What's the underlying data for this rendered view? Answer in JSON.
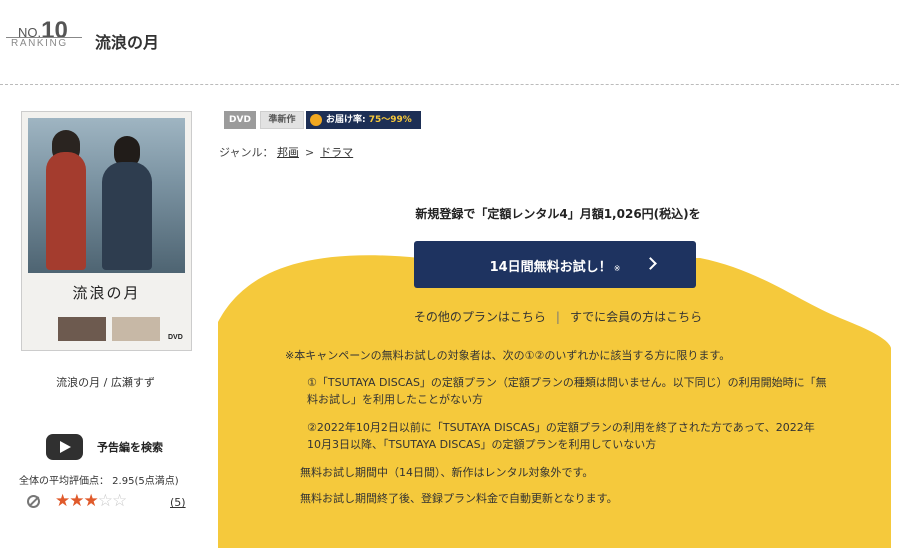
{
  "ranking": {
    "no_prefix": "NO.",
    "number": "10",
    "label": "RANKING"
  },
  "title": "流浪の月",
  "jacket": {
    "title": "流浪の月",
    "disc_mark": "DVD"
  },
  "cast": "流浪の月 / 広瀬すず",
  "trailer": {
    "label": "予告編を検索"
  },
  "rating": {
    "average_text": "全体の平均評価点： 2.95(5点満点)",
    "stars_filled": 3,
    "stars_total": 5,
    "review_count": "(5)"
  },
  "badges": {
    "format": "DVD",
    "status": "準新作",
    "delivery_prefix": "お届け率:",
    "delivery_value": "75〜99%"
  },
  "genre": {
    "prefix": "ジャンル：",
    "crumbs": [
      "邦画",
      "ドラマ"
    ],
    "separator": ">"
  },
  "campaign": {
    "promo": "新規登録で「定額レンタル4」月額1,026円(税込)を",
    "button_label": "14日間無料お試し！",
    "button_note": "※",
    "other_plans": "その他のプランはこちら",
    "member_link": "すでに会員の方はこちら",
    "divider": "|",
    "notes": [
      "※本キャンペーンの無料お試しの対象者は、次の①②のいずれかに該当する方に限ります。",
      "①「TSUTAYA DISCAS」の定額プラン（定額プランの種類は問いません。以下同じ）の利用開始時に「無料お試し」を利用したことがない方",
      "②2022年10月2日以前に「TSUTAYA DISCAS」の定額プランの利用を終了された方であって、2022年10月3日以降、「TSUTAYA DISCAS」の定額プランを利用していない方",
      "無料お試し期間中（14日間）、新作はレンタル対象外です。",
      "無料お試し期間終了後、登録プラン料金で自動更新となります。"
    ]
  },
  "colors": {
    "navy": "#1e3360",
    "yellow": "#f5c93c",
    "star": "#e05a2b"
  }
}
